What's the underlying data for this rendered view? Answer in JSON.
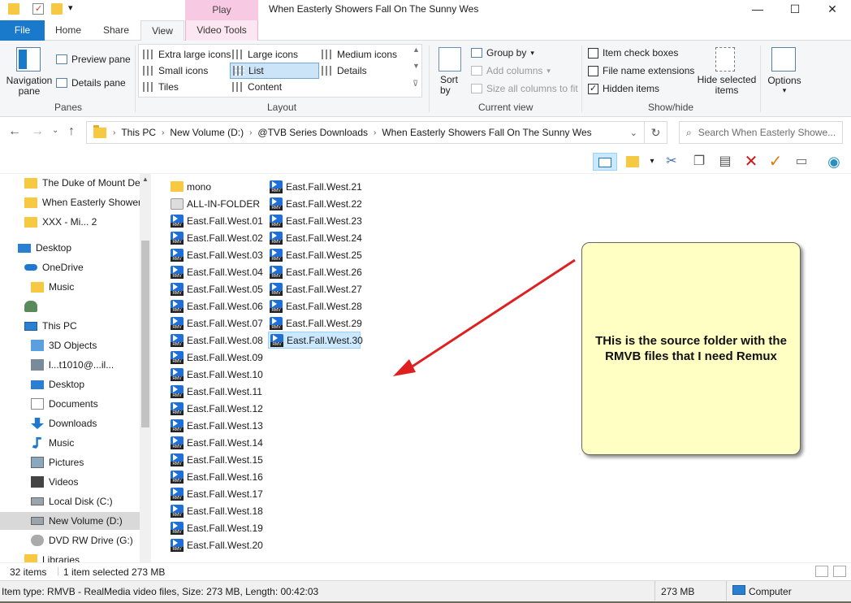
{
  "titlebar": {
    "play_tab": "Play",
    "title": "When Easterly Showers Fall On The Sunny Wes",
    "minimize": "—",
    "maximize": "☐",
    "close": "✕"
  },
  "tabs": [
    "File",
    "Home",
    "Share",
    "View",
    "Video Tools"
  ],
  "ribbon": {
    "panes": {
      "label": "Panes",
      "navigation_pane": "Navigation pane",
      "preview_pane": "Preview pane",
      "details_pane": "Details pane"
    },
    "layout": {
      "label": "Layout",
      "items": [
        "Extra large icons",
        "Large icons",
        "Medium icons",
        "Small icons",
        "List",
        "Details",
        "Tiles",
        "Content"
      ],
      "selected": "List"
    },
    "current_view": {
      "label": "Current view",
      "sort_by": "Sort by",
      "group_by": "Group by",
      "add_columns": "Add columns",
      "size_all_columns": "Size all columns to fit"
    },
    "show_hide": {
      "label": "Show/hide",
      "item_check_boxes": {
        "label": "Item check boxes",
        "checked": false
      },
      "file_name_extensions": {
        "label": "File name extensions",
        "checked": false
      },
      "hidden_items": {
        "label": "Hidden items",
        "checked": true
      },
      "hide_selected": "Hide selected items"
    },
    "options": "Options"
  },
  "address": {
    "crumbs": [
      "This PC",
      "New Volume (D:)",
      "@TVB Series Downloads",
      "When Easterly Showers Fall On The Sunny Wes"
    ],
    "search_placeholder": "Search When Easterly Showe..."
  },
  "navpane": {
    "items": [
      {
        "label": "The Duke of Mount De",
        "icon": "folder-icon"
      },
      {
        "label": "When Easterly Showers",
        "icon": "folder-icon"
      },
      {
        "label": "XXX - Mi... 2",
        "icon": "folder-icon"
      },
      {
        "label": "Desktop",
        "icon": "desktop-icon"
      },
      {
        "label": "OneDrive",
        "icon": "onedrive-icon"
      },
      {
        "label": "Music",
        "icon": "folder-icon"
      },
      {
        "label": "",
        "icon": "user-icon"
      },
      {
        "label": "This PC",
        "icon": "computer-icon"
      },
      {
        "label": "3D Objects",
        "icon": "cube-icon"
      },
      {
        "label": "l...t1010@...il...",
        "icon": "network-icon"
      },
      {
        "label": "Desktop",
        "icon": "desktop-icon"
      },
      {
        "label": "Documents",
        "icon": "documents-icon"
      },
      {
        "label": "Downloads",
        "icon": "downloads-icon"
      },
      {
        "label": "Music",
        "icon": "music-icon"
      },
      {
        "label": "Pictures",
        "icon": "pictures-icon"
      },
      {
        "label": "Videos",
        "icon": "videos-icon"
      },
      {
        "label": "Local Disk (C:)",
        "icon": "disk-icon"
      },
      {
        "label": "New Volume (D:)",
        "icon": "disk-icon",
        "selected": true
      },
      {
        "label": "DVD RW Drive (G:)",
        "icon": "dvd-icon"
      },
      {
        "label": "Libraries",
        "icon": "libraries-icon"
      }
    ]
  },
  "files": {
    "col1": [
      {
        "name": "mono",
        "type": "folder"
      },
      {
        "name": "ALL-IN-FOLDER",
        "type": "zip"
      },
      {
        "name": "East.Fall.West.01",
        "type": "rmvb"
      },
      {
        "name": "East.Fall.West.02",
        "type": "rmvb"
      },
      {
        "name": "East.Fall.West.03",
        "type": "rmvb"
      },
      {
        "name": "East.Fall.West.04",
        "type": "rmvb"
      },
      {
        "name": "East.Fall.West.05",
        "type": "rmvb"
      },
      {
        "name": "East.Fall.West.06",
        "type": "rmvb"
      },
      {
        "name": "East.Fall.West.07",
        "type": "rmvb"
      },
      {
        "name": "East.Fall.West.08",
        "type": "rmvb"
      },
      {
        "name": "East.Fall.West.09",
        "type": "rmvb"
      },
      {
        "name": "East.Fall.West.10",
        "type": "rmvb"
      },
      {
        "name": "East.Fall.West.11",
        "type": "rmvb"
      },
      {
        "name": "East.Fall.West.12",
        "type": "rmvb"
      },
      {
        "name": "East.Fall.West.13",
        "type": "rmvb"
      },
      {
        "name": "East.Fall.West.14",
        "type": "rmvb"
      },
      {
        "name": "East.Fall.West.15",
        "type": "rmvb"
      },
      {
        "name": "East.Fall.West.16",
        "type": "rmvb"
      },
      {
        "name": "East.Fall.West.17",
        "type": "rmvb"
      },
      {
        "name": "East.Fall.West.18",
        "type": "rmvb"
      },
      {
        "name": "East.Fall.West.19",
        "type": "rmvb"
      },
      {
        "name": "East.Fall.West.20",
        "type": "rmvb"
      }
    ],
    "col2": [
      {
        "name": "East.Fall.West.21",
        "type": "rmvb"
      },
      {
        "name": "East.Fall.West.22",
        "type": "rmvb"
      },
      {
        "name": "East.Fall.West.23",
        "type": "rmvb"
      },
      {
        "name": "East.Fall.West.24",
        "type": "rmvb"
      },
      {
        "name": "East.Fall.West.25",
        "type": "rmvb"
      },
      {
        "name": "East.Fall.West.26",
        "type": "rmvb"
      },
      {
        "name": "East.Fall.West.27",
        "type": "rmvb"
      },
      {
        "name": "East.Fall.West.28",
        "type": "rmvb"
      },
      {
        "name": "East.Fall.West.29",
        "type": "rmvb"
      },
      {
        "name": "East.Fall.West.30",
        "type": "rmvb",
        "selected": true
      }
    ]
  },
  "callout": {
    "text": "THis is the source folder with the RMVB files that I need Remux"
  },
  "status": {
    "item_count": "32 items",
    "selected": "1 item selected  273 MB",
    "details": "Item type: RMVB - RealMedia video files, Size: 273 MB, Length: 00:42:03",
    "size": "273 MB",
    "location": "Computer"
  },
  "colors": {
    "accent": "#1979ca",
    "selection": "#cce8ff",
    "callout_bg": "#ffffc4",
    "arrow": "#e02020"
  }
}
